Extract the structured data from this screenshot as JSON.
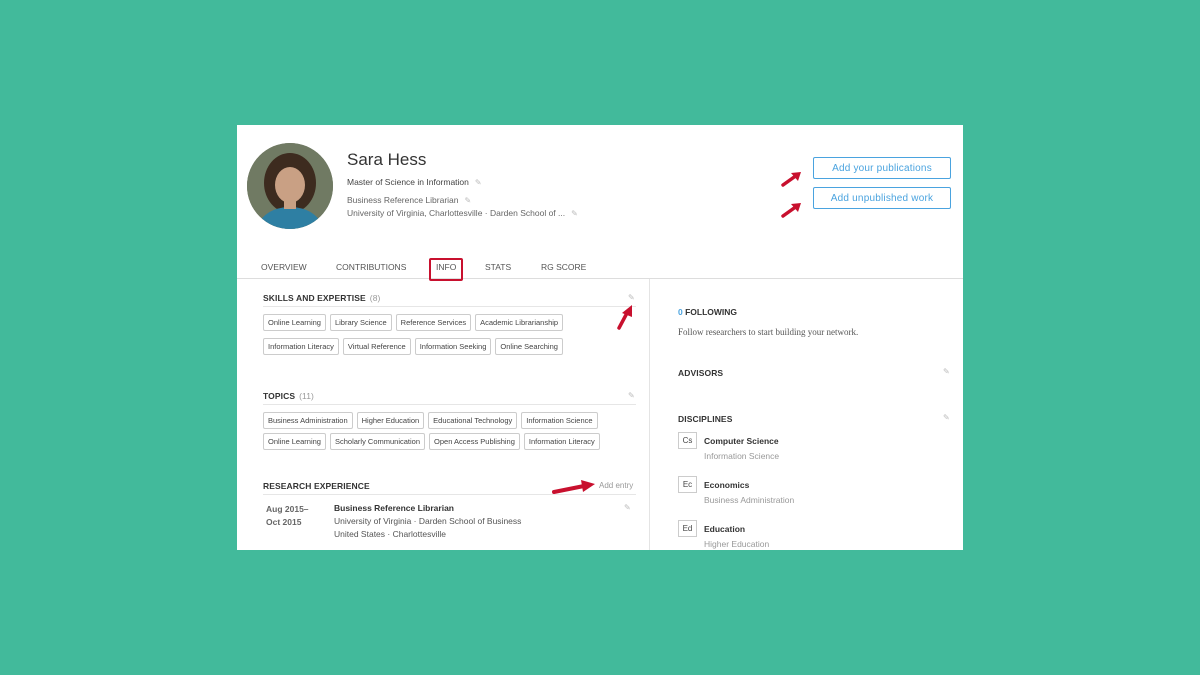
{
  "profile": {
    "name": "Sara Hess",
    "degree": "Master of Science in Information",
    "position": "Business Reference Librarian",
    "institution": "University of Virginia, Charlottesville · Darden School of ..."
  },
  "actions": {
    "add_publications": "Add your publications",
    "add_unpublished": "Add unpublished work"
  },
  "tabs": [
    {
      "label": "OVERVIEW"
    },
    {
      "label": "CONTRIBUTIONS"
    },
    {
      "label": "INFO"
    },
    {
      "label": "STATS"
    },
    {
      "label": "RG SCORE"
    }
  ],
  "skills": {
    "title": "SKILLS AND EXPERTISE",
    "count": "(8)",
    "row1": [
      "Online Learning",
      "Library Science",
      "Reference Services",
      "Academic Librarianship"
    ],
    "row2": [
      "Information Literacy",
      "Virtual Reference",
      "Information Seeking",
      "Online Searching"
    ]
  },
  "topics": {
    "title": "TOPICS",
    "count": "(11)",
    "row1": [
      "Business Administration",
      "Higher Education",
      "Educational Technology",
      "Information Science"
    ],
    "row2": [
      "Online Learning",
      "Scholarly Communication",
      "Open Access Publishing",
      "Information Literacy"
    ]
  },
  "research": {
    "title": "RESEARCH EXPERIENCE",
    "add_entry": "Add entry",
    "date_start": "Aug 2015–",
    "date_end": "Oct 2015",
    "role": "Business Reference Librarian",
    "org": "University of Virginia · Darden School of Business",
    "location": "United States · Charlottesville"
  },
  "following": {
    "count": "0",
    "label": "FOLLOWING",
    "hint": "Follow researchers to start building your network."
  },
  "advisors": {
    "title": "ADVISORS"
  },
  "disciplines": {
    "title": "DISCIPLINES",
    "items": [
      {
        "abbr": "Cs",
        "name": "Computer Science",
        "sub": "Information Science"
      },
      {
        "abbr": "Ec",
        "name": "Economics",
        "sub": "Business Administration"
      },
      {
        "abbr": "Ed",
        "name": "Education",
        "sub": "Higher Education"
      }
    ]
  },
  "colors": {
    "background": "#42ba9b",
    "accent_blue": "#4aa3df",
    "annotation_red": "#c8102e"
  }
}
